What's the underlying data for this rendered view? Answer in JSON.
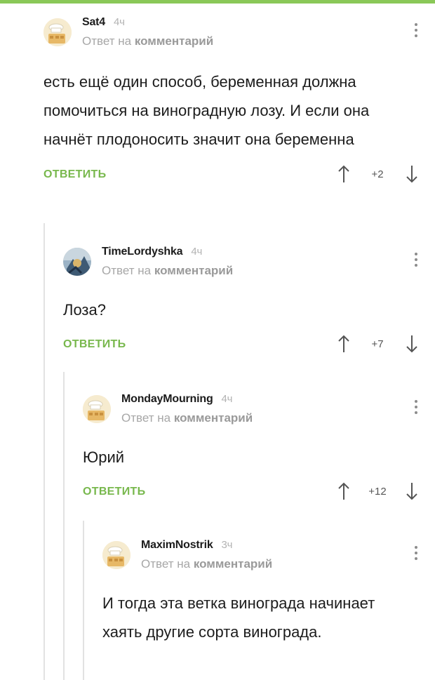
{
  "colors": {
    "accent": "#78b84d",
    "top_bar": "#8ac858",
    "muted": "#a7a7a7"
  },
  "comments": [
    {
      "author": "Sat4",
      "time": "4ч",
      "reply_prefix": "Ответ на",
      "reply_target": "комментарий",
      "text": "есть ещё один способ, беременная должна помочиться на виноградную лозу. И если она начнёт плодоносить значит она беременна",
      "reply_label": "ОТВЕТИТЬ",
      "score": "+2",
      "avatar": "default-chef-avatar"
    },
    {
      "author": "TimeLordyshka",
      "time": "4ч",
      "reply_prefix": "Ответ на",
      "reply_target": "комментарий",
      "text": "Лоза?",
      "reply_label": "ОТВЕТИТЬ",
      "score": "+7",
      "avatar": "custom-photo-avatar"
    },
    {
      "author": "MondayMourning",
      "time": "4ч",
      "reply_prefix": "Ответ на",
      "reply_target": "комментарий",
      "text": "Юрий",
      "reply_label": "ОТВЕТИТЬ",
      "score": "+12",
      "avatar": "default-chef-avatar"
    },
    {
      "author": "MaximNostrik",
      "time": "3ч",
      "reply_prefix": "Ответ на",
      "reply_target": "комментарий",
      "text": "И тогда эта ветка винограда начинает хаять другие сорта винограда.",
      "avatar": "default-chef-avatar"
    }
  ]
}
